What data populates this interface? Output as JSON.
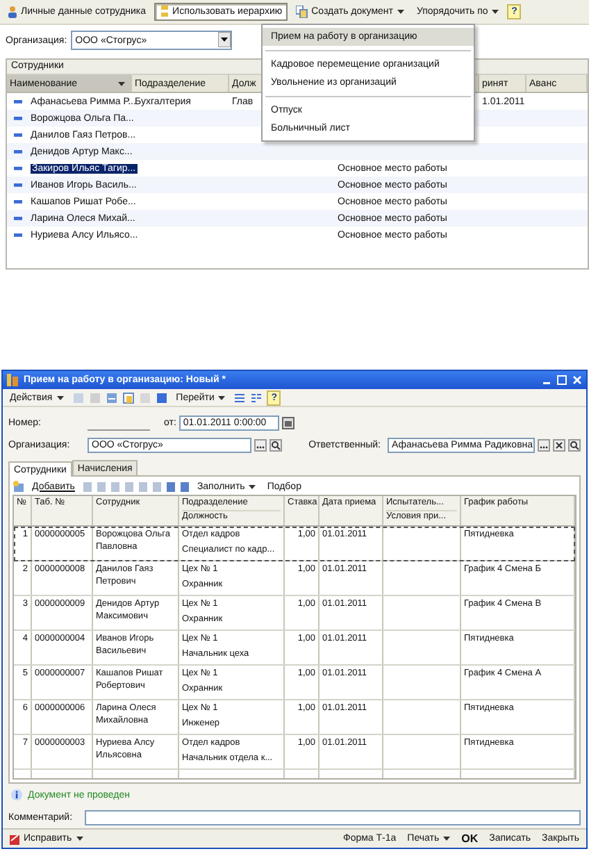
{
  "top_toolbar": {
    "buttons": [
      {
        "kind": "plain",
        "label": "Личные данные сотрудника",
        "on": false
      },
      {
        "kind": "plain",
        "label": "Использовать иерархию",
        "on": true
      },
      {
        "kind": "menu",
        "label": "Создать документ",
        "on": false
      },
      {
        "kind": "menu",
        "label": "Упорядочить по",
        "on": false
      },
      {
        "kind": "help",
        "label": "?",
        "on": false
      }
    ]
  },
  "organization_filter": {
    "label": "Организация:",
    "value": "ООО «Стогрус»"
  },
  "employee_list": {
    "title": "Сотрудники",
    "columns": [
      {
        "label": "Наименование",
        "sorted": true
      },
      {
        "label": "Подразделение",
        "sorted": false
      },
      {
        "label": "Долж",
        "sorted": false
      },
      {
        "sorted": false
      },
      {
        "label": "ринят",
        "sorted": false
      },
      {
        "label": "Аванс",
        "sorted": false
      }
    ],
    "rows": [
      {
        "cells": [
          "Афанасьева Римма Р...",
          "Бухгалтерия",
          "Глав",
          null,
          "1.01.2011",
          null
        ],
        "selected": false
      },
      {
        "cells": [
          "Ворожцова Ольга Па...",
          null,
          null,
          null,
          null,
          null
        ],
        "selected": false
      },
      {
        "cells": [
          "Данилов Гаяз Петров...",
          null,
          null,
          null,
          null,
          null
        ],
        "selected": false
      },
      {
        "cells": [
          "Денидов Артур Макс...",
          null,
          null,
          null,
          null,
          null
        ],
        "selected": false
      },
      {
        "cells": [
          "Закиров Ильяс Тагир...",
          null,
          null,
          "Основное место работы",
          null,
          null
        ],
        "selected": true
      },
      {
        "cells": [
          "Иванов Игорь Василь...",
          null,
          null,
          "Основное место работы",
          null,
          null
        ],
        "selected": false
      },
      {
        "cells": [
          "Кашапов Ришат Робе...",
          null,
          null,
          "Основное место работы",
          null,
          null
        ],
        "selected": false
      },
      {
        "cells": [
          "Ларина Олеся Михай...",
          null,
          null,
          "Основное место работы",
          null,
          null
        ],
        "selected": false
      },
      {
        "cells": [
          "Нуриева Алсу Ильясо...",
          null,
          null,
          "Основное место работы",
          null,
          null
        ],
        "selected": false
      }
    ]
  },
  "create_menu": {
    "items": [
      {
        "kind": "item",
        "label": "Прием на работу в организацию",
        "selected": true
      },
      {
        "kind": "separator"
      },
      {
        "kind": "item",
        "label": "Кадровое перемещение организаций",
        "selected": false
      },
      {
        "kind": "item",
        "label": "Увольнение из организаций",
        "selected": false
      },
      {
        "kind": "separator"
      },
      {
        "kind": "item",
        "label": "Отпуск",
        "selected": false
      },
      {
        "kind": "item",
        "label": "Больничный лист",
        "selected": false
      }
    ]
  },
  "document_window": {
    "title": "Прием на работу в организацию: Новый *",
    "toolbar": {
      "actions": "Действия",
      "goto": "Перейти",
      "help": "?"
    },
    "number": {
      "label": "Номер:"
    },
    "date": {
      "label": "от:",
      "value": "01.01.2011  0:00:00"
    },
    "organization": {
      "label": "Организация:",
      "value": "ООО «Стогрус»"
    },
    "responsible": {
      "label": "Ответственный:",
      "value": "Афанасьева Римма Радиковна"
    },
    "tabs": [
      {
        "label": "Сотрудники",
        "selected": true
      },
      {
        "label": "Начисления",
        "selected": false
      }
    ],
    "table_toolbar": {
      "add": "Добавить",
      "fill": "Заполнить",
      "pick": "Подбор"
    },
    "table": {
      "columns": [
        {
          "label": "№"
        },
        {
          "label": "Таб. №"
        },
        {
          "label": "Сотрудник"
        },
        {
          "label": "Подразделение",
          "sublabel": "Должность"
        },
        {
          "label": "Ставка"
        },
        {
          "label": "Дата приема"
        },
        {
          "label": "Испытатель...",
          "sublabel": "Условия при..."
        },
        {
          "label": "График работы"
        }
      ],
      "rows": [
        {
          "number": "1",
          "tab_no": "0000000005",
          "employee": "Ворожцова Ольга Павловна",
          "department": "Отдел кадров",
          "position": "Специалист по кадр...",
          "rate": "1,00",
          "hire_date": "01.01.2011",
          "schedule": "Пятидневка",
          "selected": true
        },
        {
          "number": "2",
          "tab_no": "0000000008",
          "employee": "Данилов Гаяз Петрович",
          "department": "Цех № 1",
          "position": "Охранник",
          "rate": "1,00",
          "hire_date": "01.01.2011",
          "schedule": "График 4 Смена Б",
          "selected": false
        },
        {
          "number": "3",
          "tab_no": "0000000009",
          "employee": "Денидов Артур Максимович",
          "department": "Цех № 1",
          "position": "Охранник",
          "rate": "1,00",
          "hire_date": "01.01.2011",
          "schedule": "График 4 Смена В",
          "selected": false
        },
        {
          "number": "4",
          "tab_no": "0000000004",
          "employee": "Иванов Игорь Васильевич",
          "department": "Цех № 1",
          "position": "Начальник цеха",
          "rate": "1,00",
          "hire_date": "01.01.2011",
          "schedule": "Пятидневка",
          "selected": false
        },
        {
          "number": "5",
          "tab_no": "0000000007",
          "employee": "Кашапов Ришат Робертович",
          "department": "Цех № 1",
          "position": "Охранник",
          "rate": "1,00",
          "hire_date": "01.01.2011",
          "schedule": "График 4 Смена А",
          "selected": false
        },
        {
          "number": "6",
          "tab_no": "0000000006",
          "employee": "Ларина Олеся Михайловна",
          "department": "Цех № 1",
          "position": "Инженер",
          "rate": "1,00",
          "hire_date": "01.01.2011",
          "schedule": "Пятидневка",
          "selected": false
        },
        {
          "number": "7",
          "tab_no": "0000000003",
          "employee": "Нуриева Алсу Ильясовна",
          "department": "Отдел кадров",
          "position": "Начальник отдела к...",
          "rate": "1,00",
          "hire_date": "01.01.2011",
          "schedule": "Пятидневка",
          "selected": false
        }
      ]
    },
    "status": "Документ не проведен",
    "comment": {
      "label": "Комментарий:"
    },
    "bottom_bar": {
      "fix": "Исправить",
      "form": "Форма Т-1а",
      "print": "Печать",
      "ok": "OK",
      "save": "Записать",
      "close": "Закрыть"
    }
  }
}
